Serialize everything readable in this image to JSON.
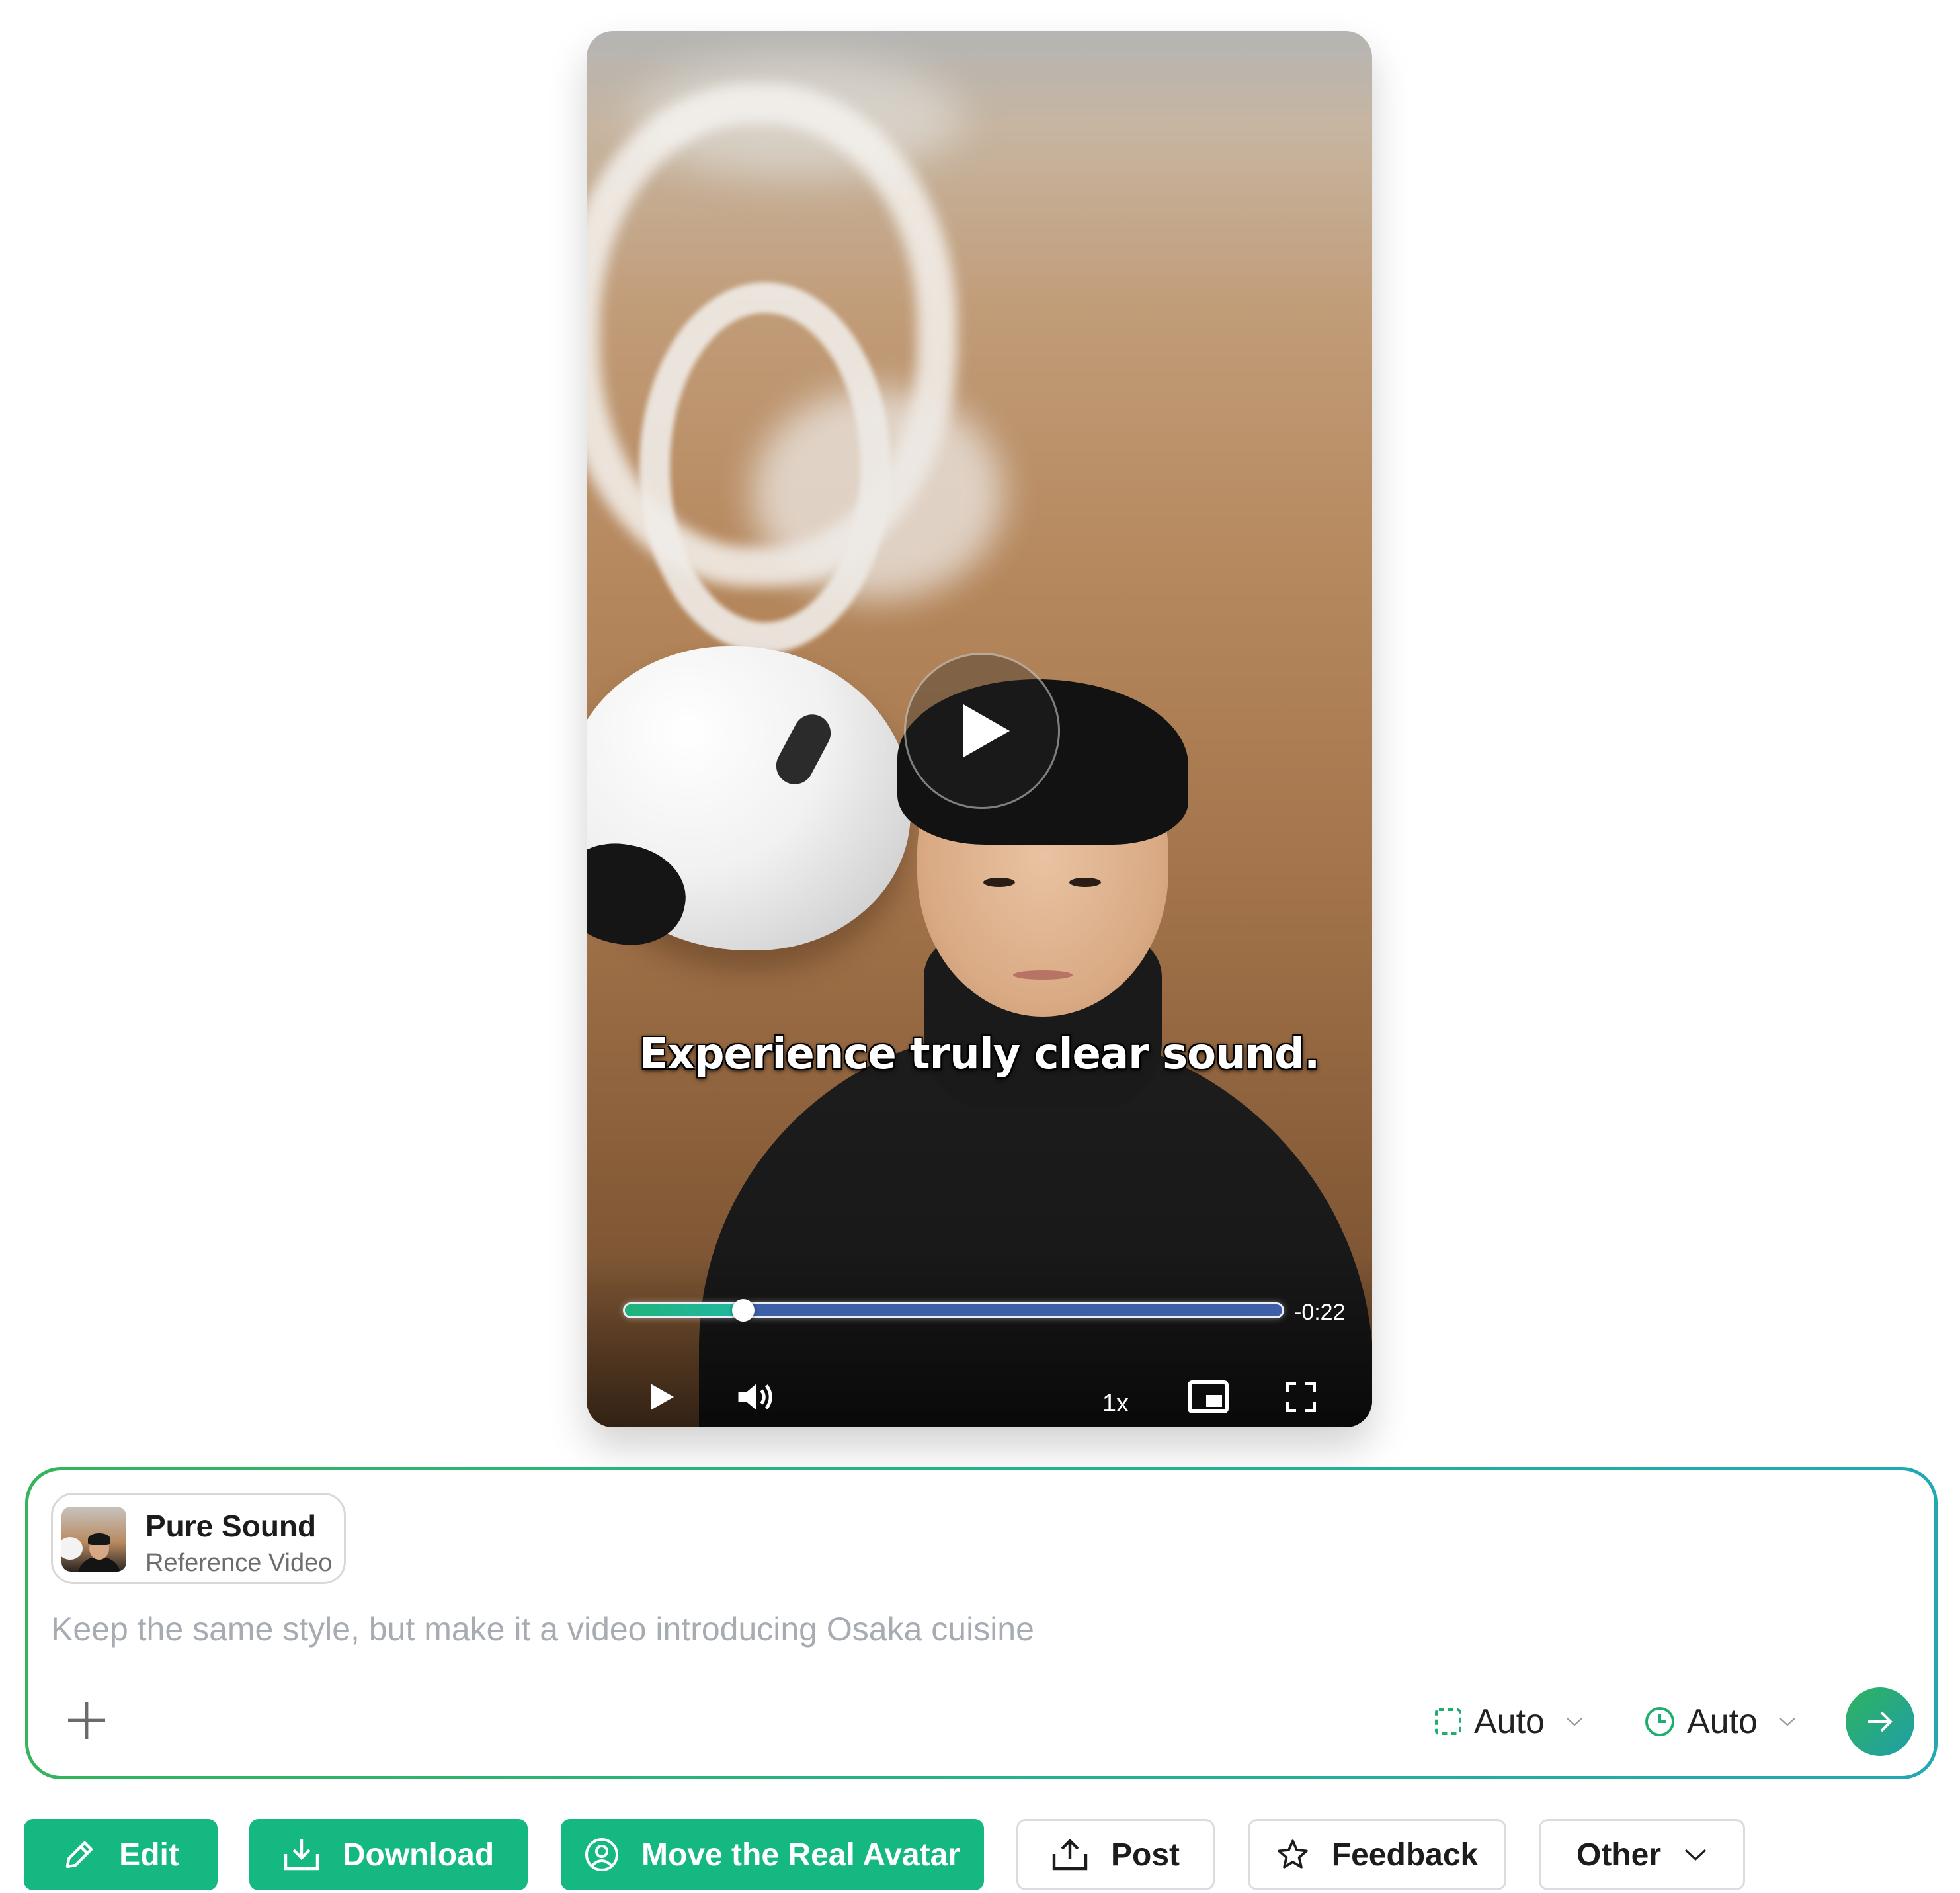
{
  "video": {
    "subtitle": "Experience truly clear sound.",
    "time_remaining": "-0:22",
    "progress_fraction": 0.18,
    "speed": "1x",
    "icons": {
      "big_play": "play-icon",
      "play": "play-icon",
      "volume": "volume-icon",
      "pip": "picture-in-picture-icon",
      "fullscreen": "fullscreen-icon"
    }
  },
  "prompt": {
    "reference": {
      "title": "Pure Sound",
      "subtitle": "Reference Video"
    },
    "placeholder": "Keep the same style, but make it a video introducing Osaka cuisine",
    "value": "",
    "aspect_ratio": "Auto",
    "duration": "Auto",
    "icons": {
      "add": "plus-icon",
      "aspect": "aspect-ratio-icon",
      "duration": "clock-icon",
      "send": "arrow-right-icon"
    }
  },
  "actions": {
    "edit": "Edit",
    "download": "Download",
    "move_avatar": "Move the Real Avatar",
    "post": "Post",
    "feedback": "Feedback",
    "other": "Other"
  },
  "colors": {
    "primary": "#16b882",
    "gradient_start": "#35b45c",
    "gradient_end": "#22a8b3",
    "progress_track": "#3d5fa8"
  }
}
